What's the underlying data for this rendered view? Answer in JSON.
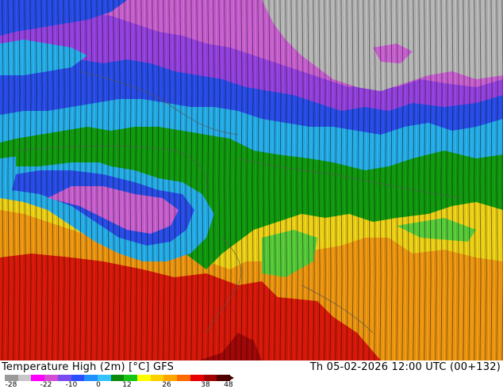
{
  "footer": {
    "title": "Temperature High (2m) [°C] GFS",
    "timestamp": "Th 05-02-2026 12:00 UTC (00+132)"
  },
  "legend": {
    "ticks": [
      "-28",
      "-22",
      "-10",
      "0",
      "12",
      "26",
      "38",
      "48"
    ],
    "colors": [
      "#9a9a9a",
      "#c8c8c8",
      "#ff00ff",
      "#d44cd4",
      "#7a4cf0",
      "#2c4cff",
      "#1e90ff",
      "#34c3ff",
      "#0c8a0c",
      "#15c415",
      "#ffff00",
      "#ffd000",
      "#ffa500",
      "#ff6a00",
      "#e80000",
      "#a00000",
      "#500000"
    ]
  },
  "map": {
    "zones": [
      {
        "name": "gray",
        "color": "#bdbdbd",
        "value": -28
      },
      {
        "name": "magenta",
        "color": "#d064d8",
        "value": -22
      },
      {
        "name": "purple",
        "color": "#9a44e6",
        "value": -16
      },
      {
        "name": "blue",
        "color": "#2a50f0",
        "value": -10
      },
      {
        "name": "cyan",
        "color": "#28b4f0",
        "value": -4
      },
      {
        "name": "green",
        "color": "#12a010",
        "value": 2
      },
      {
        "name": "light-green",
        "color": "#5ad23c",
        "value": 8
      },
      {
        "name": "yellow",
        "color": "#f5d818",
        "value": 14
      },
      {
        "name": "orange",
        "color": "#f59c12",
        "value": 20
      },
      {
        "name": "red",
        "color": "#e01a0a",
        "value": 26
      },
      {
        "name": "dark-red",
        "color": "#a80808",
        "value": 32
      }
    ]
  }
}
